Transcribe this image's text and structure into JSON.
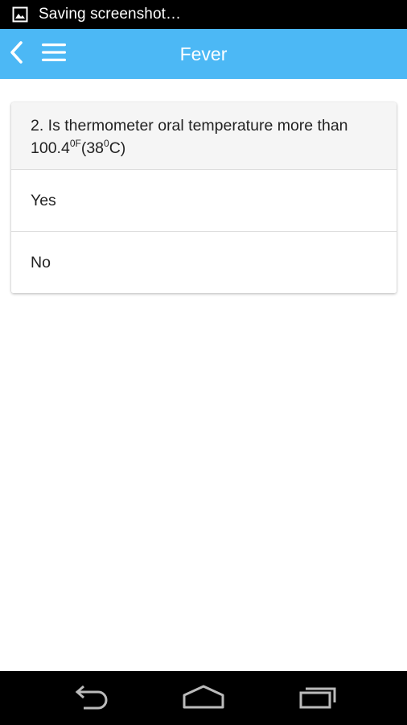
{
  "status_bar": {
    "notification_icon": "image-icon",
    "text": "Saving screenshot…"
  },
  "app_bar": {
    "back_icon": "chevron-left-icon",
    "menu_icon": "hamburger-menu-icon",
    "title": "Fever",
    "background_color": "#4cb8f5"
  },
  "question": {
    "text_main": "2. Is thermometer oral temperature more than 100.4",
    "sup_1": "0F",
    "text_mid": "(38",
    "sup_2": "0",
    "text_end": "C)"
  },
  "options": [
    {
      "label": "Yes"
    },
    {
      "label": "No"
    }
  ],
  "nav_bar": {
    "back_icon": "nav-back-icon",
    "home_icon": "nav-home-icon",
    "recents_icon": "nav-recents-icon"
  }
}
